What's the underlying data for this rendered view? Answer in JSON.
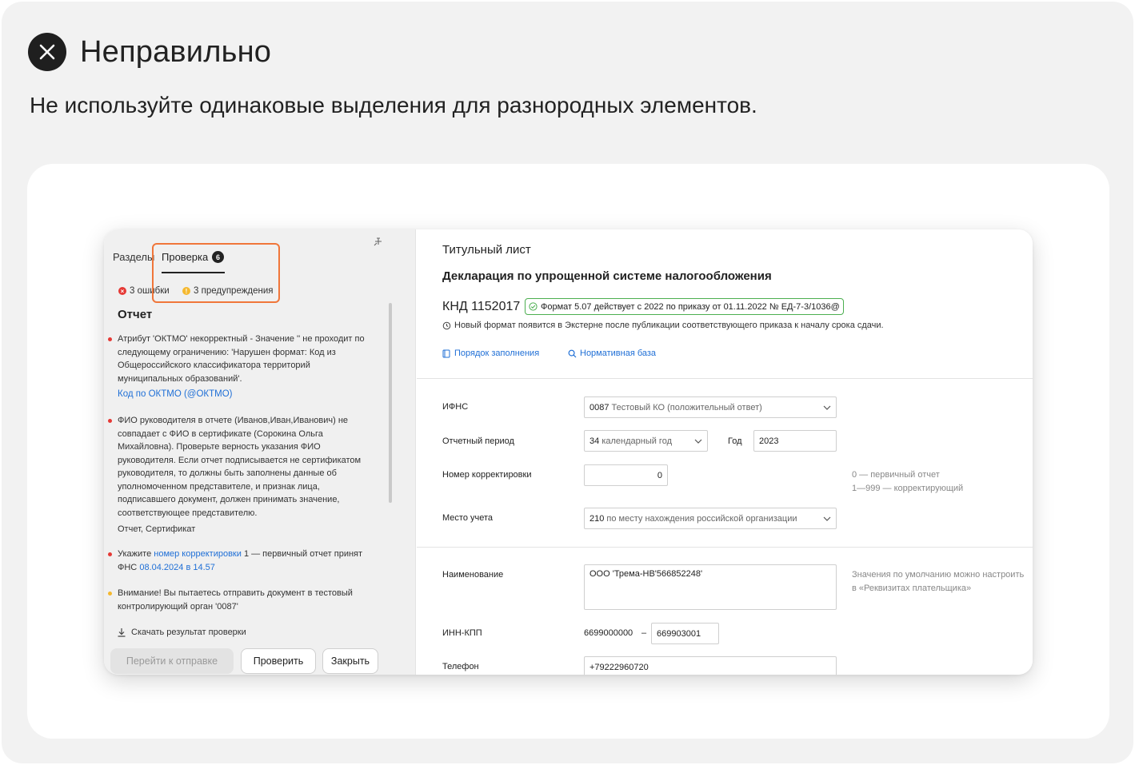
{
  "heading": {
    "title": "Неправильно",
    "subtitle": "Не используйте одинаковые выделения для разнородных элементов."
  },
  "colors": {
    "highlight": "#f0763a",
    "error": "#e53935",
    "warning": "#f5b82e",
    "link": "#1f6fd6",
    "success": "#4caf50"
  },
  "left_panel": {
    "tabs": [
      "Разделы",
      "Проверка"
    ],
    "check_count": "6",
    "errors_label": "3 ошибки",
    "warnings_label": "3 предупреждения",
    "report_title": "Отчет",
    "messages": [
      {
        "type": "error",
        "text": "Атрибут 'ОКТМО' некорректный - Значение '' не проходит по следующему ограничению: 'Нарушен формат: Код из Общероссийского классификатора территорий муниципальных образований'.",
        "link": "Код по ОКТМО (@ОКТМО)"
      },
      {
        "type": "error",
        "text": "ФИО руководителя в отчете (Иванов,Иван,Иванович) не совпадает с ФИО в сертификате (Сорокина Ольга Михайловна). Проверьте верность указания ФИО руководителя. Если отчет подписывается не сертификатом руководителя, то должны быть заполнены данные об уполномоченном представителе, и признак лица, подписавшего документ, должен принимать значение, соответствующее представителю.",
        "footer": "Отчет, Сертификат"
      },
      {
        "type": "error",
        "prefix": "Укажите",
        "link": "номер корректировки",
        "middle": "1 — первичный отчет принят ФНС",
        "link2": "08.04.2024 в 14.57"
      },
      {
        "type": "warning",
        "text": "Внимание! Вы пытаетесь отправить документ в тестовый контролирующий орган '0087'"
      }
    ],
    "download_label": "Скачать результат проверки",
    "buttons": {
      "send": "Перейти к отправке",
      "check": "Проверить",
      "close": "Закрыть"
    }
  },
  "right_panel": {
    "section_title": "Титульный лист",
    "declaration_title": "Декларация по упрощенной системе налогообложения",
    "knd": "КНД 1152017",
    "format_badge": "Формат 5.07 действует с 2022 по приказу от 01.11.2022 № ЕД-7-3/1036@",
    "new_format_note": "Новый формат появится в Экстерне после публикации соответствующего приказа к началу срока сдачи.",
    "links": {
      "procedure": "Порядок заполнения",
      "normative": "Нормативная база"
    },
    "form": {
      "ifns_label": "ИФНС",
      "ifns_code": "0087",
      "ifns_text": "Тестовый КО (положительный ответ)",
      "period_label": "Отчетный период",
      "period_code": "34",
      "period_text": "календарный год",
      "year_label": "Год",
      "year_value": "2023",
      "correction_label": "Номер корректировки",
      "correction_value": "0",
      "correction_hint_1": "0 — первичный отчет",
      "correction_hint_2": "1—999 — корректирующий",
      "place_label": "Место учета",
      "place_code": "210",
      "place_text": "по месту нахождения российской организации",
      "name_label": "Наименование",
      "name_value": "ООО 'Трема-НВ'566852248'",
      "name_hint_1": "Значения по умолчанию можно настроить",
      "name_hint_2": "в «Реквизитах плательщика»",
      "inn_label": "ИНН-КПП",
      "inn_value": "6699000000",
      "inn_dash": "–",
      "kpp_value": "669903001",
      "phone_label": "Телефон",
      "phone_value": "+79222960720"
    }
  }
}
